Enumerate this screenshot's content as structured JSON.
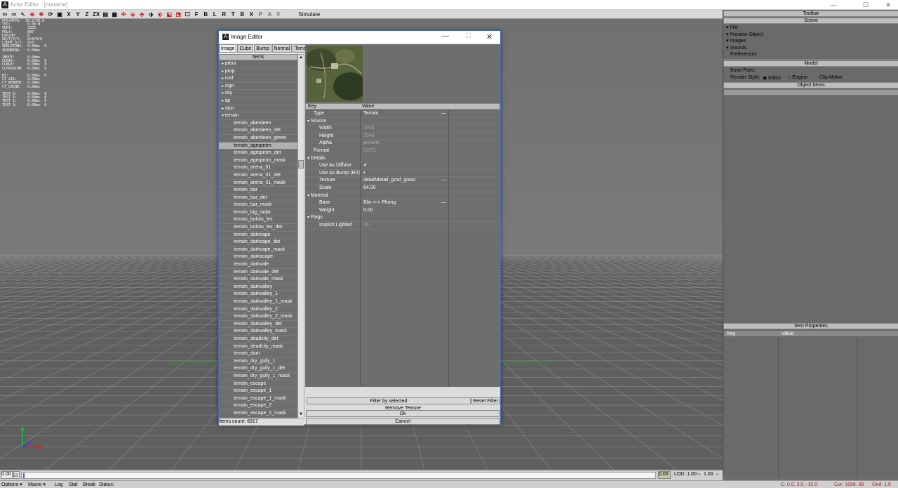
{
  "window": {
    "title": "Actor Editor - [noname]",
    "minimize": "—",
    "maximize": "☐",
    "close": "✕"
  },
  "toolbar": {
    "letters": [
      "X",
      "Y",
      "Z",
      "ZX",
      "F",
      "B",
      "L",
      "R",
      "T",
      "B",
      "X",
      "P",
      "A",
      "F"
    ],
    "simulate": "Simulate"
  },
  "stats": "FPS/RFPS:  16.9/30.0\nTPS:        0.00 M\nVERT:       2283\nPOLY:       887\nDIP/DP:     8\nSH/T/V/C:   0/0/0/0\nLIGHT S/T:  0/0\nSKELETONS:  0.00ms  0\nSKINNING:   0.00ms\n\nINPUT:      0.00ms\nCLRAY:      0.00ms  0\nCLBOX:      0.00ms  0\nCLFRUSTUM:  0.00ms  0\n\nRT:         0.00ms  0\nCT_VIS:     0.00ms\nCT_RENDER:  0.00ms\nCT_CACHE:   0.00ms\n\nTEST 0:     0.00ms  0\nTEST 1:     0.00ms  0\nTEST 2:     0.00ms  0\nTEST 3:     0.00ms  0",
  "rightpanel": {
    "toolbar_header": "Toolbar",
    "scene_header": "Scene",
    "scene_items": [
      "File",
      "Preview Object",
      "Images",
      "Sounds",
      "Preferences"
    ],
    "model_header": "Model",
    "bone_parts": "Bone Parts",
    "render_style": "Render Style:",
    "editor": "Editor",
    "engine": "Engine",
    "clip_maker": "Clip Maker",
    "object_items": "Object Items",
    "item_properties": "Item Properties",
    "col_key": "Key",
    "col_value": "Value"
  },
  "dialog": {
    "title": "Image Editor",
    "tabs": [
      "Image",
      "Cube",
      "Bump",
      "Normal",
      "Terrain"
    ],
    "items_header": "Items",
    "items": [
      {
        "label": "prboi",
        "folder": true
      },
      {
        "label": "prop",
        "folder": true
      },
      {
        "label": "roof",
        "folder": true
      },
      {
        "label": "sign",
        "folder": true
      },
      {
        "label": "sky",
        "folder": true
      },
      {
        "label": "sp",
        "folder": true
      },
      {
        "label": "ston",
        "folder": true
      },
      {
        "label": "terrain",
        "folder": true,
        "open": true
      },
      {
        "label": "terrain_aberdeen"
      },
      {
        "label": "terrain_aberdeen_det"
      },
      {
        "label": "terrain_aberdeen_green"
      },
      {
        "label": "terrain_agroprom",
        "selected": true
      },
      {
        "label": "terrain_agroprom_det"
      },
      {
        "label": "terrain_agroprom_mask"
      },
      {
        "label": "terrain_arena_01"
      },
      {
        "label": "terrain_arena_01_det"
      },
      {
        "label": "terrain_arena_01_mask"
      },
      {
        "label": "terrain_bar"
      },
      {
        "label": "terrain_bar_det"
      },
      {
        "label": "terrain_bar_mask"
      },
      {
        "label": "terrain_big_radar"
      },
      {
        "label": "terrain_boloto_lex"
      },
      {
        "label": "terrain_boloto_lex_det"
      },
      {
        "label": "terrain_darkcape"
      },
      {
        "label": "terrain_darkcape_det"
      },
      {
        "label": "terrain_darkcape_mask"
      },
      {
        "label": "terrain_darkscape"
      },
      {
        "label": "terrain_darkvale"
      },
      {
        "label": "terrain_darkvale_det"
      },
      {
        "label": "terrain_darkvale_mask"
      },
      {
        "label": "terrain_darkvalley"
      },
      {
        "label": "terrain_darkvalley_1"
      },
      {
        "label": "terrain_darkvalley_1_mask"
      },
      {
        "label": "terrain_darkvalley_2"
      },
      {
        "label": "terrain_darkvalley_2_mask"
      },
      {
        "label": "terrain_darkvalley_det"
      },
      {
        "label": "terrain_darkvalley_mask"
      },
      {
        "label": "terrain_deadcity_det"
      },
      {
        "label": "terrain_deadcity_mask"
      },
      {
        "label": "terrain_dom"
      },
      {
        "label": "terrain_dry_gully_1"
      },
      {
        "label": "terrain_dry_gully_1_det"
      },
      {
        "label": "terrain_dry_gully_1_mask"
      },
      {
        "label": "terrain_escape"
      },
      {
        "label": "terrain_escape_1"
      },
      {
        "label": "terrain_escape_1_mask"
      },
      {
        "label": "terrain_escape_2"
      },
      {
        "label": "terrain_escape_2_mask"
      }
    ],
    "items_count": "Items count: 6917",
    "props": {
      "col_key": "Key",
      "col_value": "Value",
      "rows": [
        {
          "k": "Type",
          "v": "Terrain",
          "level": 1,
          "dash": true
        },
        {
          "k": "Source",
          "v": "",
          "level": 0,
          "group": true
        },
        {
          "k": "Width",
          "v": "2048",
          "level": 2,
          "gray": true
        },
        {
          "k": "Height",
          "v": "2048",
          "level": 2,
          "gray": true
        },
        {
          "k": "Alpha",
          "v": "present",
          "level": 2,
          "gray": true
        },
        {
          "k": "Format",
          "v": "DXT1",
          "level": 1,
          "gray": true
        },
        {
          "k": "Details",
          "v": "",
          "level": 0,
          "group": true
        },
        {
          "k": "Use As Diffuse",
          "v": "✔",
          "level": 2
        },
        {
          "k": "Use As Bump (R2)",
          "v": "•",
          "level": 2
        },
        {
          "k": "Texture",
          "v": "detail\\detail_grnd_grass",
          "level": 2,
          "dash": true
        },
        {
          "k": "Scale",
          "v": "64.00",
          "level": 2
        },
        {
          "k": "Material",
          "v": "",
          "level": 0,
          "group": true
        },
        {
          "k": "Base",
          "v": "Blin <-> Phong",
          "level": 2,
          "dash": true
        },
        {
          "k": "Weight",
          "v": "0.00",
          "level": 2
        },
        {
          "k": "Flags",
          "v": "",
          "level": 0,
          "group": true
        },
        {
          "k": "Implicit Lighted",
          "v": "on",
          "level": 2,
          "gray": true
        }
      ]
    },
    "filter_button": "Filter by selected",
    "reset_filter": "Reset Filter",
    "remove_texture": "Remove Texture",
    "ok": "Ok",
    "cancel": "Cancel"
  },
  "timeline": {
    "left_value": "0.00",
    "right_value": "0.00",
    "lod_label": "LOD: 1.00",
    "lod_value": "1.00"
  },
  "statusbar": {
    "items": [
      "Options",
      "Macro",
      "Log",
      "Stat",
      "Break",
      "Status:"
    ],
    "camera": "C: 0.0, 3.0, -10.0",
    "cursor": "Cur: 1656, 88",
    "grid": "Grid: 1.0"
  }
}
